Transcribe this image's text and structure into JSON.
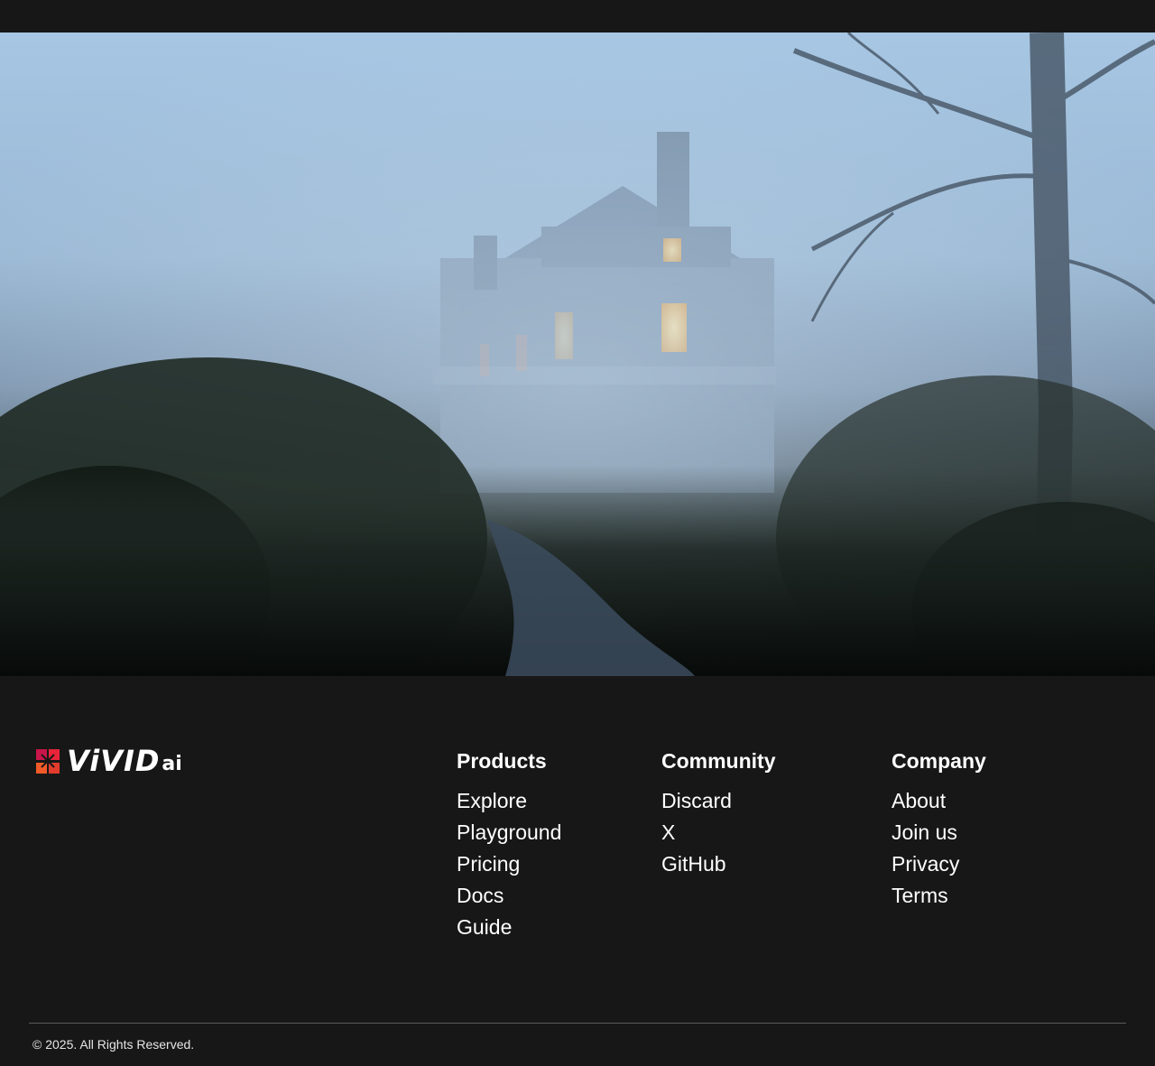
{
  "hero": {
    "image": "foggy-mansion-photo"
  },
  "brand": {
    "wordmark": "ViVID",
    "suffix": "ai",
    "colors": {
      "mark_primary": "#e8243a",
      "mark_secondary": "#f05a28"
    }
  },
  "footer": {
    "products": {
      "heading": "Products",
      "items": [
        {
          "label": "Explore"
        },
        {
          "label": "Playground"
        },
        {
          "label": "Pricing"
        },
        {
          "label": "Docs"
        },
        {
          "label": "Guide"
        }
      ]
    },
    "community": {
      "heading": "Community",
      "items": [
        {
          "label": "Discard"
        },
        {
          "label": "X"
        },
        {
          "label": "GitHub"
        }
      ]
    },
    "company": {
      "heading": "Company",
      "items": [
        {
          "label": "About"
        },
        {
          "label": "Join us"
        },
        {
          "label": "Privacy"
        },
        {
          "label": "Terms"
        }
      ]
    },
    "copyright": "© 2025. All Rights Reserved."
  },
  "colors": {
    "background": "#171717",
    "text": "#ffffff"
  }
}
